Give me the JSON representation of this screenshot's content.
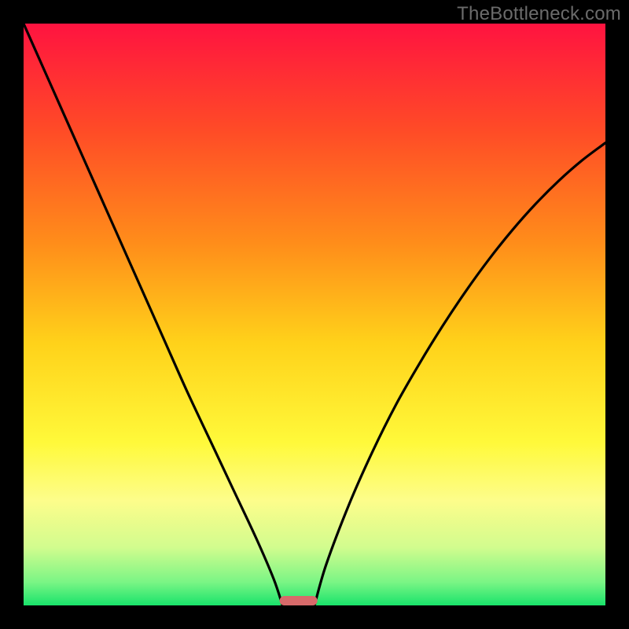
{
  "watermark": "TheBottleneck.com",
  "chart_data": {
    "type": "line",
    "title": "",
    "xlabel": "",
    "ylabel": "",
    "xlim": [
      0,
      1
    ],
    "ylim": [
      0,
      1
    ],
    "gradient_stops": [
      {
        "offset": 0.0,
        "color": "#ff1340"
      },
      {
        "offset": 0.18,
        "color": "#ff4a27"
      },
      {
        "offset": 0.38,
        "color": "#ff8e1a"
      },
      {
        "offset": 0.55,
        "color": "#ffd21a"
      },
      {
        "offset": 0.72,
        "color": "#fff93a"
      },
      {
        "offset": 0.82,
        "color": "#fdfd8b"
      },
      {
        "offset": 0.9,
        "color": "#d2fc8e"
      },
      {
        "offset": 0.96,
        "color": "#7af585"
      },
      {
        "offset": 1.0,
        "color": "#19e36b"
      }
    ],
    "series": [
      {
        "name": "left-curve",
        "x": [
          0.0,
          0.04,
          0.08,
          0.12,
          0.16,
          0.2,
          0.24,
          0.28,
          0.32,
          0.36,
          0.4,
          0.43,
          0.445
        ],
        "y": [
          1.0,
          0.91,
          0.82,
          0.73,
          0.64,
          0.55,
          0.46,
          0.37,
          0.285,
          0.2,
          0.115,
          0.045,
          0.0
        ]
      },
      {
        "name": "right-curve",
        "x": [
          0.5,
          0.52,
          0.56,
          0.6,
          0.64,
          0.68,
          0.72,
          0.76,
          0.8,
          0.84,
          0.88,
          0.92,
          0.96,
          1.0
        ],
        "y": [
          0.0,
          0.07,
          0.175,
          0.265,
          0.345,
          0.415,
          0.48,
          0.54,
          0.595,
          0.645,
          0.69,
          0.73,
          0.765,
          0.795
        ]
      }
    ],
    "marker": {
      "x_center": 0.4725,
      "width": 0.065,
      "color": "#d76a6a"
    }
  }
}
